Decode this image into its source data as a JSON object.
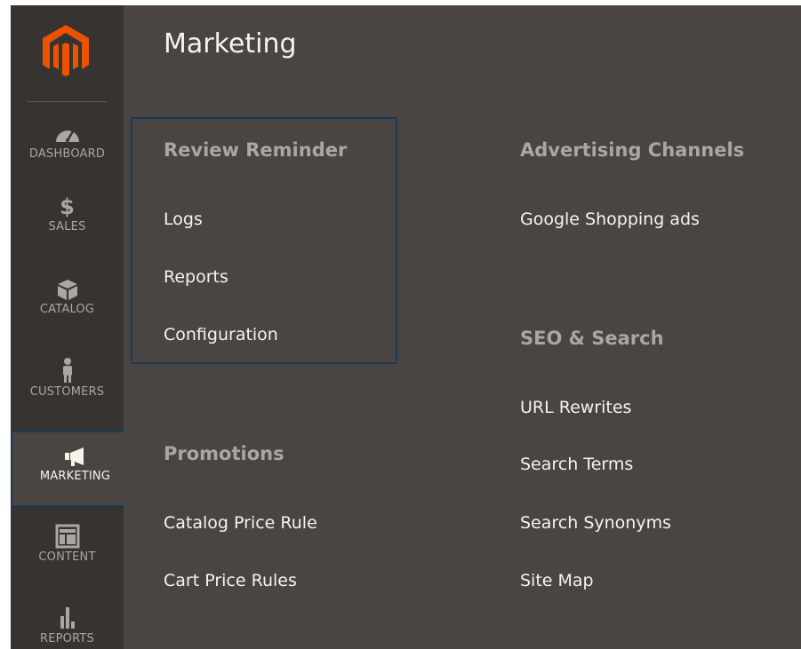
{
  "sidebar": {
    "logo_name": "magento-logo",
    "items": [
      {
        "label": "DASHBOARD",
        "icon": "dashboard-gauge-icon"
      },
      {
        "label": "SALES",
        "icon": "dollar-icon"
      },
      {
        "label": "CATALOG",
        "icon": "box-icon"
      },
      {
        "label": "CUSTOMERS",
        "icon": "person-icon"
      },
      {
        "label": "MARKETING",
        "icon": "megaphone-icon",
        "active": true
      },
      {
        "label": "CONTENT",
        "icon": "layout-icon"
      },
      {
        "label": "REPORTS",
        "icon": "bar-chart-icon"
      }
    ],
    "sales_symbol": "$"
  },
  "panel": {
    "title": "Marketing",
    "review_reminder": {
      "title": "Review Reminder",
      "links": [
        "Logs",
        "Reports",
        "Configuration"
      ]
    },
    "promotions": {
      "title": "Promotions",
      "links": [
        "Catalog Price Rule",
        "Cart Price Rules"
      ]
    },
    "advertising_channels": {
      "title": "Advertising Channels",
      "links": [
        "Google Shopping ads"
      ]
    },
    "seo_search": {
      "title": "SEO & Search",
      "links": [
        "URL Rewrites",
        "Search Terms",
        "Search Synonyms",
        "Site Map"
      ]
    }
  },
  "colors": {
    "sidebar_bg": "#373330",
    "panel_bg": "#4a4542",
    "logo_orange": "#eb5202",
    "focus_border": "#1a3b57",
    "text_light": "#f7f3eb",
    "text_muted": "#aaa6a0"
  }
}
